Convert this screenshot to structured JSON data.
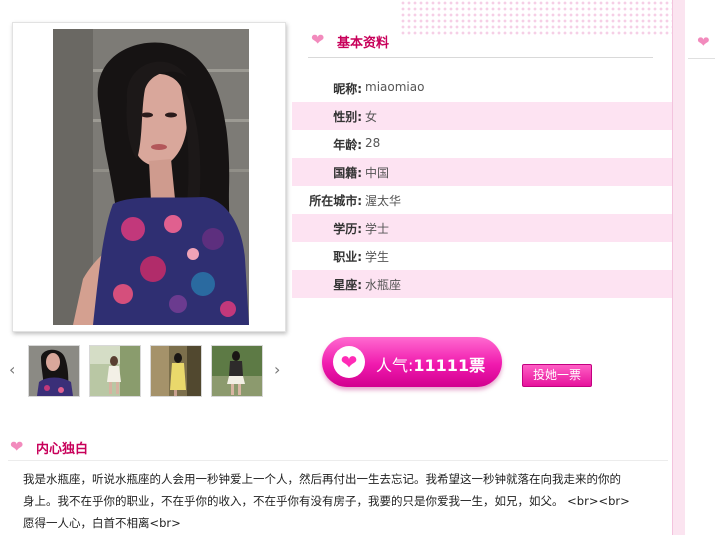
{
  "profile": {
    "title": "基本资料",
    "fields": [
      {
        "label": "昵称:",
        "value": "miaomiao"
      },
      {
        "label": "性别:",
        "value": "女"
      },
      {
        "label": "年龄:",
        "value": "28"
      },
      {
        "label": "国籍:",
        "value": "中国"
      },
      {
        "label": "所在城市:",
        "value": "渥太华"
      },
      {
        "label": "学历:",
        "value": "学士"
      },
      {
        "label": "职业:",
        "value": "学生"
      },
      {
        "label": "星座:",
        "value": "水瓶座"
      }
    ]
  },
  "popularity": {
    "label": "人气:",
    "count": "11111",
    "unit": "票"
  },
  "vote_button": "投她一票",
  "monologue": {
    "title": "内心独白",
    "line1": "我是水瓶座，听说水瓶座的人会用一秒钟爱上一个人，然后再付出一生去忘记。我希望这一秒钟就落在向我走来的你的",
    "line2": "身上。我不在乎你的职业，不在乎你的收入，不在乎你有没有房子，我要的只是你爱我一生，如兄，如父。 <br><br>",
    "line3": "愿得一人心，白首不相离<br>"
  },
  "icons": {
    "heart": "heart-icon",
    "prev": "chevron-left-icon",
    "next": "chevron-right-icon"
  },
  "colors": {
    "accent": "#c8005a",
    "pink_light": "#fde3f2",
    "button_pink": "#f01aae"
  }
}
